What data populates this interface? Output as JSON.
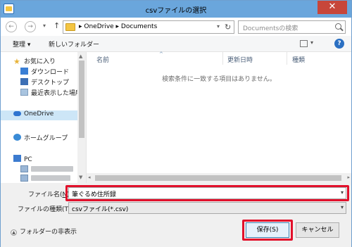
{
  "window": {
    "title": "csvファイルの選択",
    "close_label": "✕"
  },
  "nav": {
    "back_glyph": "←",
    "forward_glyph": "→",
    "dropdown_glyph": "▾",
    "up_glyph": "↑",
    "address_path": "▸  OneDrive  ▸  Documents",
    "refresh_glyph": "↻",
    "search_placeholder": "Documentsの検索"
  },
  "toolbar": {
    "organize_label": "整理 ▾",
    "new_folder_label": "新しいフォルダー",
    "view_drop_glyph": "▾",
    "help_glyph": "?"
  },
  "sidebar": {
    "items": [
      {
        "label": "お気に入り",
        "icon": "star-icon"
      },
      {
        "label": "ダウンロード",
        "icon": "download-folder-icon"
      },
      {
        "label": "デスクトップ",
        "icon": "desktop-folder-icon"
      },
      {
        "label": "最近表示した場所",
        "icon": "recent-places-icon"
      },
      {
        "label": "OneDrive",
        "icon": "onedrive-cloud-icon"
      },
      {
        "label": "ホームグループ",
        "icon": "homegroup-icon"
      },
      {
        "label": "PC",
        "icon": "pc-icon"
      }
    ],
    "scroll_up_glyph": "▲",
    "scroll_down_glyph": "▼"
  },
  "content": {
    "columns": [
      "名前",
      "更新日時",
      "種類"
    ],
    "sort_glyph": "^",
    "empty_message": "検索条件に一致する項目はありません。",
    "scroll_left_glyph": "◂",
    "scroll_right_glyph": "▸"
  },
  "bottom": {
    "filename_label_prefix": "ファイル名(",
    "filename_label_key": "N",
    "filename_label_suffix": "):",
    "filename_value": "筆ぐるめ住所録",
    "filename_drop_glyph": "▾",
    "filetype_label": "ファイルの種類(T):",
    "filetype_value": "csvファイル(*.csv)",
    "filetype_drop_glyph": "▾",
    "toggle_glyph": "▲",
    "hide_folders_label": "フォルダーの非表示",
    "save_label": "保存(S)",
    "cancel_label": "キャンセル"
  },
  "colors": {
    "title_bar": "#6aa6dc",
    "close_button": "#c7463a",
    "highlight_frame": "#e2102b",
    "selected_item": "#cde6f7"
  }
}
